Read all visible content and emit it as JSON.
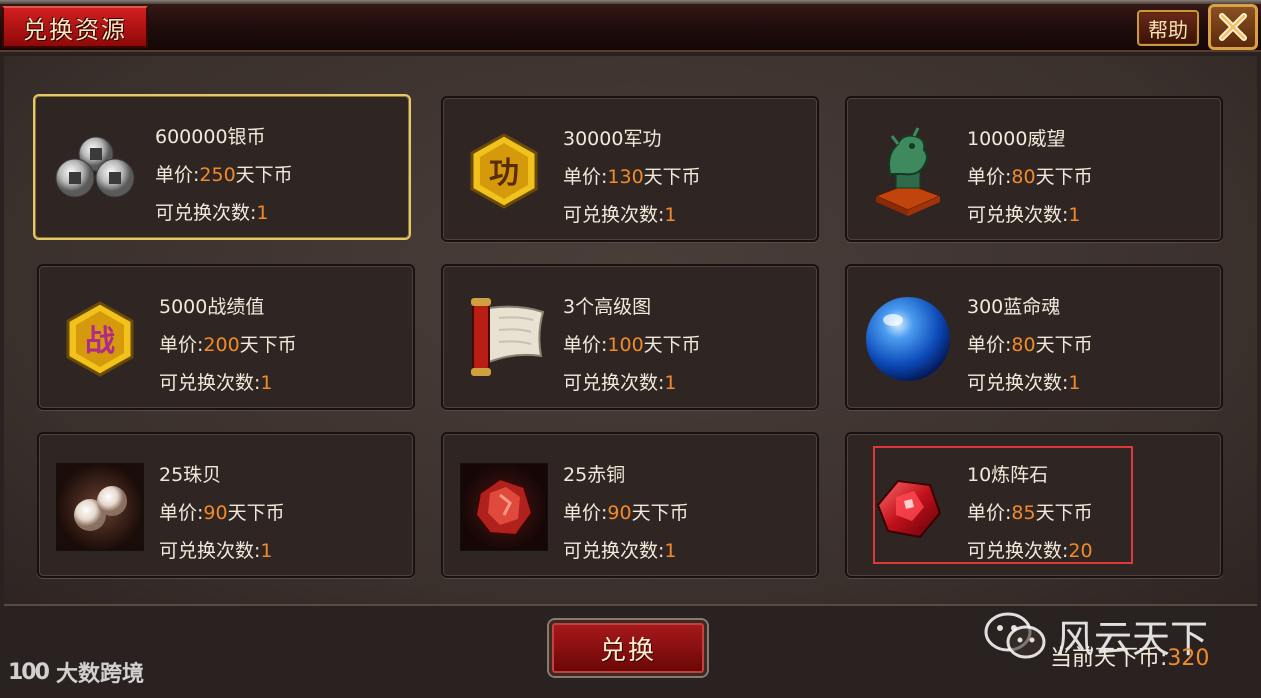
{
  "window": {
    "title": "兑换资源",
    "help_label": "帮助"
  },
  "cards": [
    {
      "name": "600000银币",
      "price_prefix": "单价:",
      "price": "250",
      "price_unit": "天下币",
      "count_prefix": "可兑换次数:",
      "count": "1",
      "icon": "silver-coins-icon"
    },
    {
      "name": "30000军功",
      "price_prefix": "单价:",
      "price": "130",
      "price_unit": "天下币",
      "count_prefix": "可兑换次数:",
      "count": "1",
      "icon": "merit-badge-icon",
      "badge_char": "功"
    },
    {
      "name": "10000威望",
      "price_prefix": "单价:",
      "price": "80",
      "price_unit": "天下币",
      "count_prefix": "可兑换次数:",
      "count": "1",
      "icon": "dragon-seal-icon"
    },
    {
      "name": "5000战绩值",
      "price_prefix": "单价:",
      "price": "200",
      "price_unit": "天下币",
      "count_prefix": "可兑换次数:",
      "count": "1",
      "icon": "battle-badge-icon",
      "badge_char": "战"
    },
    {
      "name": "3个高级图",
      "price_prefix": "单价:",
      "price": "100",
      "price_unit": "天下币",
      "count_prefix": "可兑换次数:",
      "count": "1",
      "icon": "scroll-icon"
    },
    {
      "name": "300蓝命魂",
      "price_prefix": "单价:",
      "price": "80",
      "price_unit": "天下币",
      "count_prefix": "可兑换次数:",
      "count": "1",
      "icon": "blue-orb-icon"
    },
    {
      "name": "25珠贝",
      "price_prefix": "单价:",
      "price": "90",
      "price_unit": "天下币",
      "count_prefix": "可兑换次数:",
      "count": "1",
      "icon": "pearls-icon"
    },
    {
      "name": "25赤铜",
      "price_prefix": "单价:",
      "price": "90",
      "price_unit": "天下币",
      "count_prefix": "可兑换次数:",
      "count": "1",
      "icon": "red-copper-icon"
    },
    {
      "name": "10炼阵石",
      "price_prefix": "单价:",
      "price": "85",
      "price_unit": "天下币",
      "count_prefix": "可兑换次数:",
      "count": "20",
      "icon": "red-gem-icon"
    }
  ],
  "footer": {
    "exchange_label": "兑换",
    "currency_label": "当前天下币:",
    "currency_value": "320"
  },
  "watermarks": {
    "left_logo": "100",
    "left_text": "大数跨境",
    "right_text": "风云天下"
  },
  "colors": {
    "highlight": "#f08a2a",
    "selected_border": "#e4c86a",
    "marked_border": "#e03838",
    "title_red": "#c01818"
  }
}
